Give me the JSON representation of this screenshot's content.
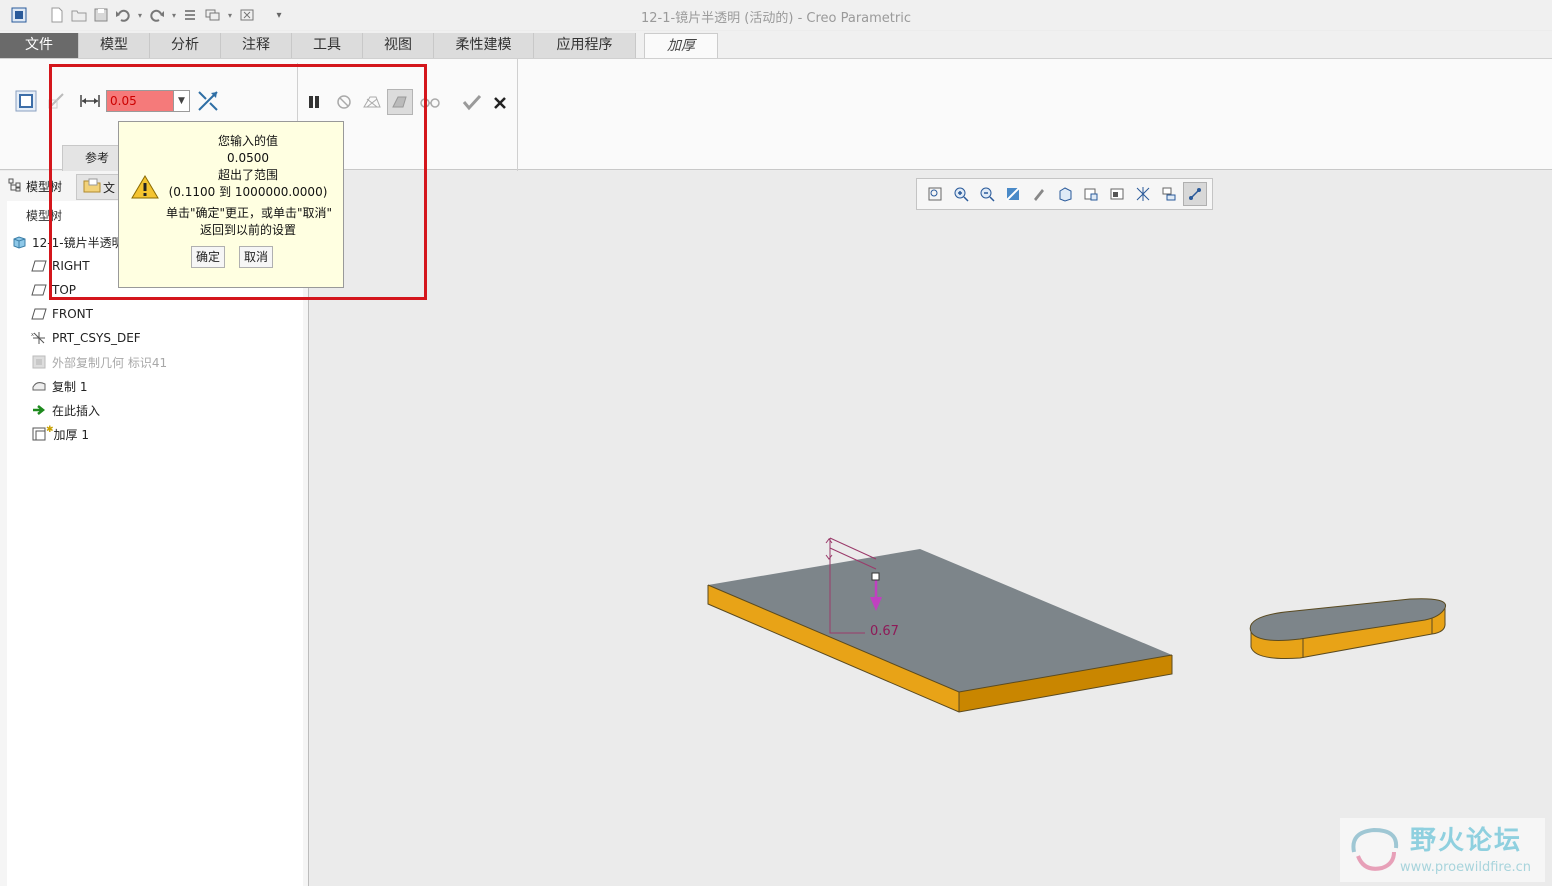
{
  "window": {
    "title": "12-1-镜片半透明 (活动的) - Creo Parametric"
  },
  "tabs": [
    "文件",
    "模型",
    "分析",
    "注释",
    "工具",
    "视图",
    "柔性建模",
    "应用程序",
    "加厚"
  ],
  "ribbon": {
    "thickness_value": "0.05",
    "references_tab": "参考"
  },
  "tooltip": {
    "line1": "您输入的值",
    "line2": "0.0500",
    "line3": "超出了范围",
    "line4": "(0.1100 到 1000000.0000)",
    "line5": "单击\"确定\"更正，或单击\"取消\"",
    "line6": "返回到以前的设置",
    "ok_label": "确定",
    "cancel_label": "取消"
  },
  "left_panel": {
    "tab_model_tree": "模型树",
    "tab_files": "文",
    "tree_header": "模型树",
    "items": [
      {
        "label": "12-1-镜片半透明"
      },
      {
        "label": "RIGHT"
      },
      {
        "label": "TOP"
      },
      {
        "label": "FRONT"
      },
      {
        "label": "PRT_CSYS_DEF"
      },
      {
        "label": "外部复制几何 标识41"
      },
      {
        "label": "复制 1"
      },
      {
        "label": "在此插入"
      },
      {
        "label": "加厚 1"
      }
    ]
  },
  "graphics": {
    "dimension_value": "0.67"
  },
  "watermark": {
    "text": "野火论坛",
    "url": "www.proewildfire.cn"
  },
  "colors": {
    "accent_red": "#d4161c",
    "error_input": "#f57a7a",
    "part_side": "#e8a317",
    "part_top": "#7d858a",
    "dimension": "#8e1a58"
  }
}
